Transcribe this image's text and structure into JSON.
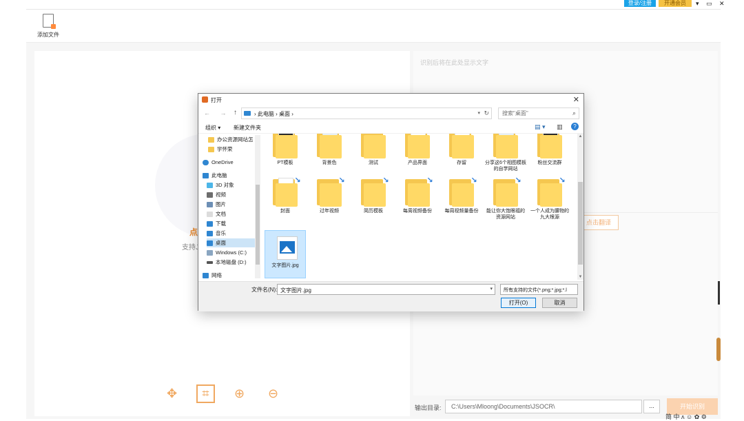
{
  "app": {
    "login_label": "登录/注册",
    "vip_label": "开通会员",
    "window_controls": "▾ ▭ ✕",
    "add_file_label": "添加文件",
    "click_hint": "点",
    "support_hint": "支持J",
    "right_placeholder": "识别后将在此处显示文字",
    "translate_label": "点击翻译",
    "output_label": "输出目录:",
    "output_path": "C:\\Users\\Mloong\\Documents\\JSOCR\\",
    "browse_label": "...",
    "start_label": "开始识别",
    "ime_indicator": "简 中 ʌ ☺ ✿ ⚙"
  },
  "dialog": {
    "title": "打开",
    "close_glyph": "✕",
    "nav_back_forward": "← →",
    "nav_up": "↑",
    "breadcrumb": "›  此电脑  ›  桌面  ›",
    "refresh_glyph": "↻",
    "search_placeholder": "搜索\"桌面\"",
    "organize_label": "组织 ▾",
    "new_folder_label": "新建文件夹",
    "view_glyph": "▤ ▾",
    "pane_glyph": "▥",
    "help_glyph": "?",
    "nav_items": [
      {
        "label": "办公资源网站怎"
      },
      {
        "label": "学怀荣"
      },
      {
        "label": "OneDrive"
      },
      {
        "label": "此电脑"
      },
      {
        "label": "3D 对象"
      },
      {
        "label": "视频"
      },
      {
        "label": "图片"
      },
      {
        "label": "文档"
      },
      {
        "label": "下载"
      },
      {
        "label": "音乐"
      },
      {
        "label": "桌面"
      },
      {
        "label": "Windows (C:)"
      },
      {
        "label": "本地磁盘 (D:)"
      },
      {
        "label": "网络"
      }
    ],
    "files_row1": [
      {
        "name": "PT模板"
      },
      {
        "name": "背景色"
      },
      {
        "name": "测试"
      },
      {
        "name": "产品界面"
      },
      {
        "name": "存留"
      },
      {
        "name": "分享这6个相图模板的自学网站"
      },
      {
        "name": "粉丝交流群"
      }
    ],
    "files_row2": [
      {
        "name": "封面"
      },
      {
        "name": "过年视频"
      },
      {
        "name": "简历模板"
      },
      {
        "name": "每周视频备份"
      },
      {
        "name": "每周视频量备份"
      },
      {
        "name": "能让你大饱眼福的资源网站"
      },
      {
        "name": "一个人成为腰物的九大根源"
      }
    ],
    "selected_file": "文字图片.jpg",
    "filename_label": "文件名(N):",
    "filename_value": "文字图片.jpg",
    "file_type": "所有支持的文件(*.png;*.jpg;*.l",
    "open_label": "打开(O)",
    "cancel_label": "取消"
  }
}
